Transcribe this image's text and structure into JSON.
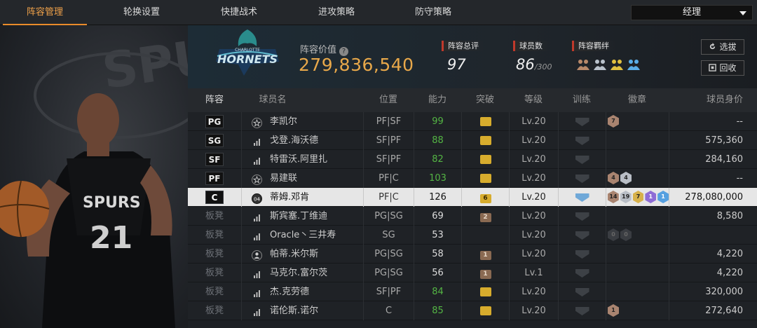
{
  "nav": {
    "tabs": [
      "阵容管理",
      "轮换设置",
      "快捷战术",
      "进攻策略",
      "防守策略"
    ],
    "active_tab": 0,
    "role_select": "经理"
  },
  "team": {
    "logo_text": "CHARLOTTE HORNETS",
    "value_label": "阵容价值",
    "value": "279,836,540",
    "stats": [
      {
        "label": "阵容总评",
        "value": "97",
        "suffix": ""
      },
      {
        "label": "球员数",
        "value": "86",
        "suffix": "/300"
      },
      {
        "label": "阵容羁绊",
        "value": "",
        "suffix": ""
      }
    ],
    "buttons": {
      "draft": "选拔",
      "recycle": "回收"
    }
  },
  "colors": {
    "accent": "#e98b2a",
    "value": "#e8a84a",
    "green": "#54b544",
    "gold": "#d7ac2d"
  },
  "table": {
    "headers": [
      "阵容",
      "球员名",
      "位置",
      "能力",
      "突破",
      "等级",
      "训练",
      "徽章",
      "球员身价"
    ],
    "rows": [
      {
        "slot": "PG",
        "bench": false,
        "rank_icon": "star-icon",
        "name": "李凯尔",
        "pos": "PF|SF",
        "ability": "99",
        "green": true,
        "break": "",
        "break_color": "gold",
        "level": "Lv.20",
        "train": false,
        "badges": [
          {
            "v": "7",
            "c": "b-bronze"
          }
        ],
        "price": "--",
        "selected": false
      },
      {
        "slot": "SG",
        "bench": false,
        "rank_icon": "bars-icon",
        "name": "戈登.海沃德",
        "pos": "SF|PF",
        "ability": "88",
        "green": true,
        "break": "",
        "break_color": "gold",
        "level": "Lv.20",
        "train": false,
        "badges": [],
        "price": "575,360",
        "selected": false
      },
      {
        "slot": "SF",
        "bench": false,
        "rank_icon": "bars-icon",
        "name": "特雷沃.阿里扎",
        "pos": "SF|PF",
        "ability": "82",
        "green": true,
        "break": "",
        "break_color": "gold",
        "level": "Lv.20",
        "train": false,
        "badges": [],
        "price": "284,160",
        "selected": false
      },
      {
        "slot": "PF",
        "bench": false,
        "rank_icon": "star-icon",
        "name": "易建联",
        "pos": "PF|C",
        "ability": "103",
        "green": true,
        "break": "",
        "break_color": "gold",
        "level": "Lv.20",
        "train": false,
        "badges": [
          {
            "v": "4",
            "c": "b-bronze"
          },
          {
            "v": "4",
            "c": "b-silver"
          }
        ],
        "price": "--",
        "selected": false
      },
      {
        "slot": "C",
        "bench": false,
        "rank_icon": "medal-icon",
        "rank_text": "04",
        "name": "蒂姆.邓肯",
        "pos": "PF|C",
        "ability": "126",
        "green": false,
        "break": "6",
        "break_color": "gold",
        "level": "Lv.20",
        "train": true,
        "badges": [
          {
            "v": "14",
            "c": "b-bronze"
          },
          {
            "v": "19",
            "c": "b-silver"
          },
          {
            "v": "7",
            "c": "b-gold"
          },
          {
            "v": "1",
            "c": "b-purple"
          },
          {
            "v": "1",
            "c": "b-blue"
          }
        ],
        "price": "278,080,000",
        "selected": true
      },
      {
        "slot": "板凳",
        "bench": true,
        "rank_icon": "bars-icon",
        "name": "斯宾塞.丁维迪",
        "pos": "PG|SG",
        "ability": "69",
        "green": false,
        "break": "2",
        "break_color": "brown",
        "level": "Lv.20",
        "train": false,
        "badges": [],
        "price": "8,580",
        "selected": false
      },
      {
        "slot": "板凳",
        "bench": true,
        "rank_icon": "bars-icon",
        "name": "Oracle丶三井寿",
        "pos": "SG",
        "ability": "53",
        "green": false,
        "break": "",
        "break_color": "none",
        "level": "Lv.20",
        "train": false,
        "badges": [
          {
            "v": "0",
            "c": "b-dark"
          },
          {
            "v": "0",
            "c": "b-dark"
          }
        ],
        "price": "",
        "selected": false
      },
      {
        "slot": "板凳",
        "bench": true,
        "rank_icon": "person-icon",
        "name": "帕蒂.米尔斯",
        "pos": "PG|SG",
        "ability": "58",
        "green": false,
        "break": "1",
        "break_color": "brown",
        "level": "Lv.20",
        "train": false,
        "badges": [],
        "price": "4,220",
        "selected": false
      },
      {
        "slot": "板凳",
        "bench": true,
        "rank_icon": "bars-icon",
        "name": "马克尔.富尔茨",
        "pos": "PG|SG",
        "ability": "56",
        "green": false,
        "break": "1",
        "break_color": "brown",
        "level": "Lv.1",
        "train": false,
        "badges": [],
        "price": "4,220",
        "selected": false
      },
      {
        "slot": "板凳",
        "bench": true,
        "rank_icon": "bars-icon",
        "name": "杰.克劳德",
        "pos": "SF|PF",
        "ability": "84",
        "green": true,
        "break": "",
        "break_color": "gold",
        "level": "Lv.20",
        "train": false,
        "badges": [],
        "price": "320,000",
        "selected": false
      },
      {
        "slot": "板凳",
        "bench": true,
        "rank_icon": "bars-icon",
        "name": "诺伦斯.诺尔",
        "pos": "C",
        "ability": "85",
        "green": true,
        "break": "",
        "break_color": "gold",
        "level": "Lv.20",
        "train": false,
        "badges": [
          {
            "v": "1",
            "c": "b-bronze"
          }
        ],
        "price": "272,640",
        "selected": false
      }
    ]
  }
}
